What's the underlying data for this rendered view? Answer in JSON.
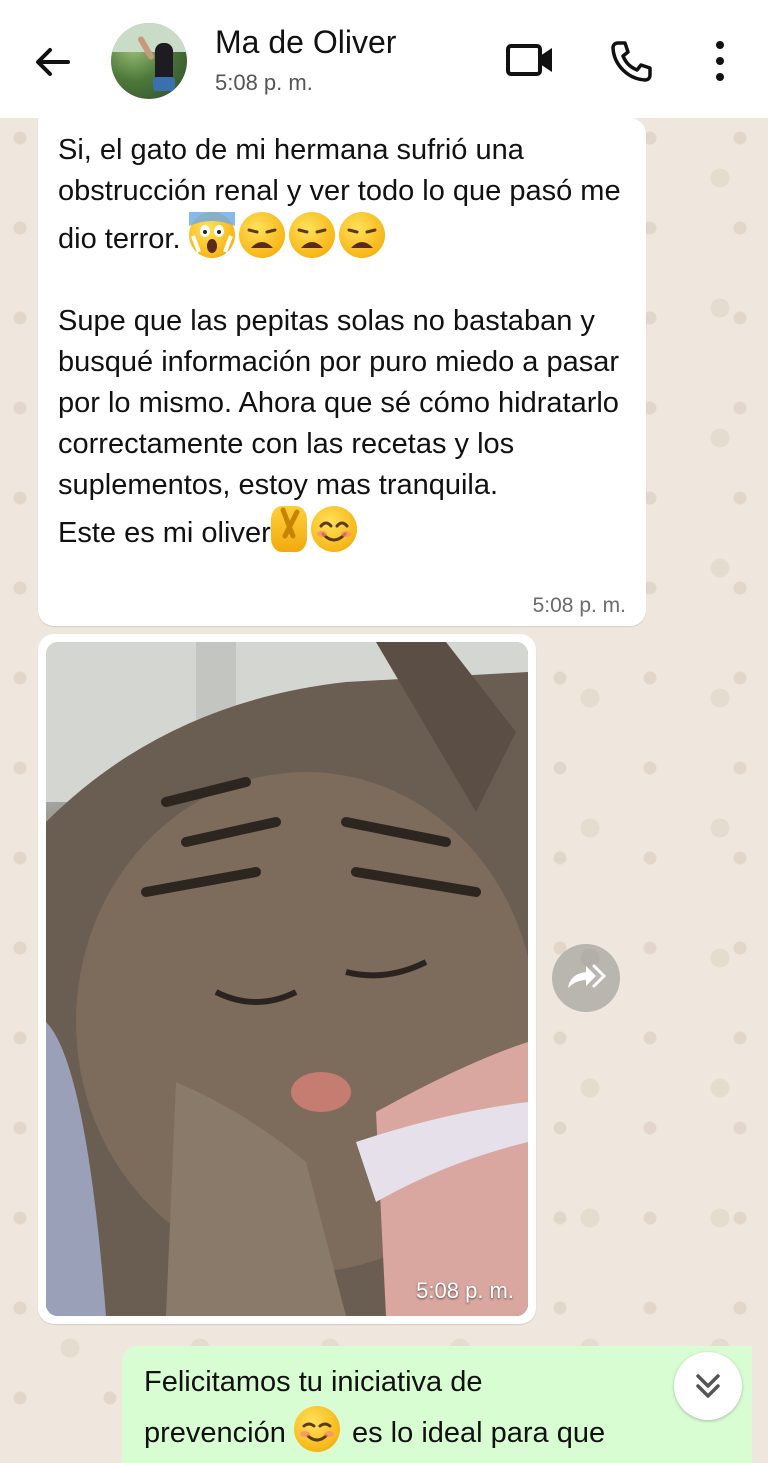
{
  "header": {
    "contact_name": "Ma de Oliver",
    "last_seen": "5:08 p. m.",
    "icons": [
      "back-arrow-icon",
      "video-call-icon",
      "phone-icon",
      "more-vertical-icon"
    ]
  },
  "messages": [
    {
      "direction": "incoming",
      "paragraphs": [
        "Si, el gato de mi hermana sufrió una obstrucción renal y ver todo lo que pasó me dio terror.",
        "Supe que las pepitas solas no bastaban y busqué información por puro miedo a pasar por lo mismo. Ahora que sé cómo hidratarlo correctamente con las recetas y los suplementos, estoy mas tranquila.",
        "Este es mi oliver"
      ],
      "emojis_line1": [
        "face-screaming-in-fear",
        "weary-face",
        "weary-face",
        "weary-face"
      ],
      "emojis_last_line": [
        "crossed-fingers",
        "smiling-face-with-smiling-eyes"
      ],
      "time": "5:08 p. m."
    },
    {
      "direction": "incoming",
      "type": "image",
      "image_subject": "sleeping tabby cat",
      "time": "5:08 p. m."
    },
    {
      "direction": "outgoing",
      "text_part1": "Felicitamos tu iniciativa de",
      "text_part2": "prevención",
      "text_part3": "es lo ideal para que",
      "emoji": "smiling-face"
    }
  ],
  "colors": {
    "header_bg": "#ffffff",
    "chat_bg": "#efe7dd",
    "incoming_bubble": "#ffffff",
    "outgoing_bubble": "#d9fdd3"
  }
}
